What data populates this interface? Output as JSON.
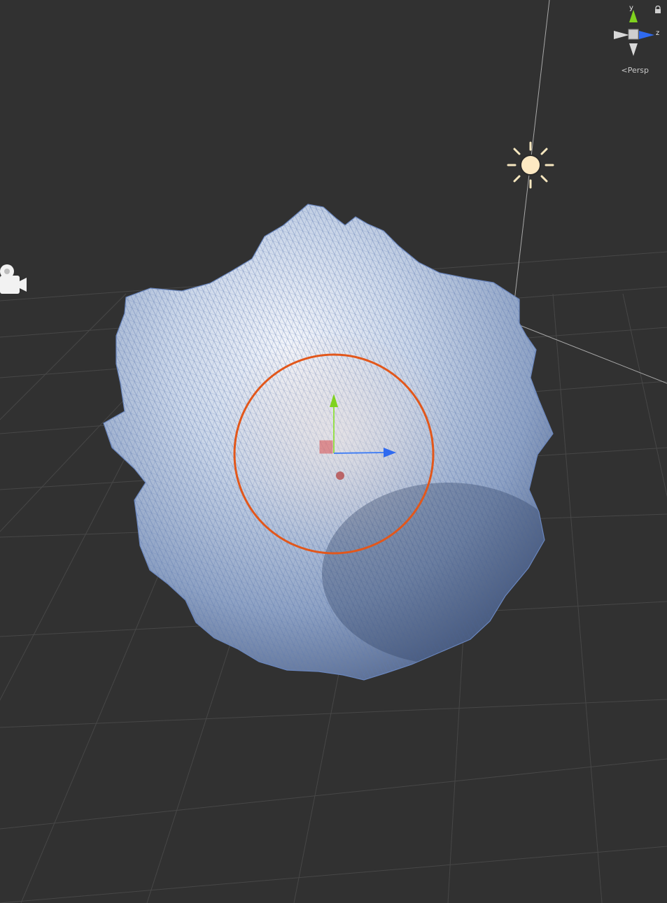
{
  "scene_view": {
    "background_color": "#313131",
    "grid_color": "#4a4a4a",
    "mesh_fill_color": "#a9bcd8",
    "mesh_wire_color": "#5c78b0",
    "selection_outline_color": "#e2571b"
  },
  "orientation_gizmo": {
    "y_label": "y",
    "z_label": "z",
    "projection_label": "Persp",
    "y_axis_color": "#7fd21e",
    "z_axis_color": "#2f6af0",
    "neutral_axis_color": "#d8d8d8"
  },
  "icons": {
    "lock": "lock-icon",
    "directional_light": "sun-icon",
    "camera": "camera-icon",
    "move_tool": "move-gizmo-icon"
  },
  "move_gizmo": {
    "y_axis_color": "#7fd21e",
    "z_axis_color": "#2f6af0",
    "x_handle_color": "#d94040"
  }
}
